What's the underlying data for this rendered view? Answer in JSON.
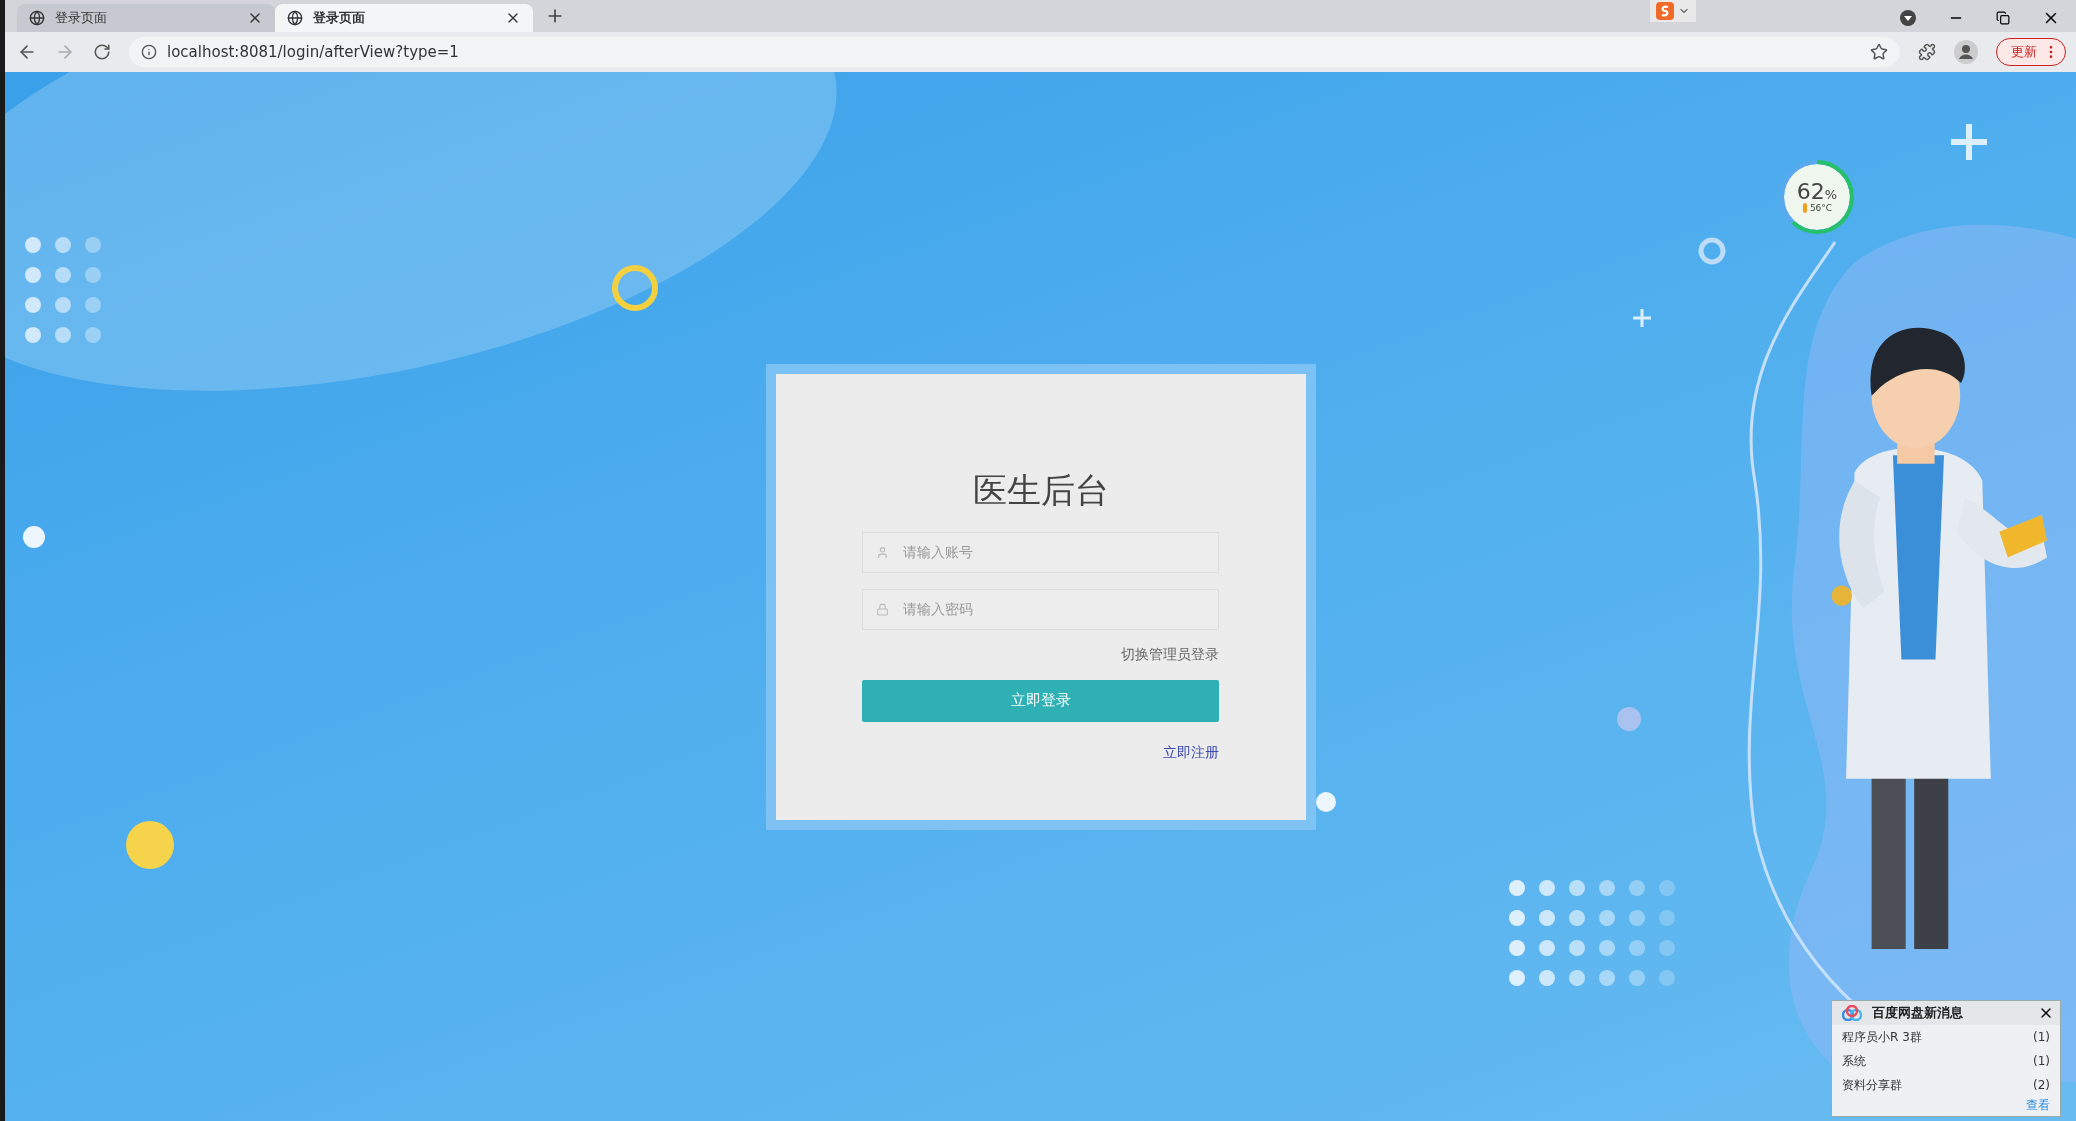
{
  "browser": {
    "tabs": [
      {
        "title": "登录页面",
        "selected": false
      },
      {
        "title": "登录页面",
        "selected": true
      }
    ],
    "address": "localhost:8081/login/afterView?type=1",
    "update_button": "更新"
  },
  "login": {
    "title": "医生后台",
    "fields": [
      {
        "kind": "user",
        "placeholder": "请输入账号"
      },
      {
        "kind": "password",
        "placeholder": "请输入密码"
      }
    ],
    "switch_link": "切换管理员登录",
    "submit": "立即登录",
    "register_link": "立即注册"
  },
  "cpu_widget": {
    "reading": "62",
    "unit": "%",
    "temperature": "56°C",
    "level": 0.62
  },
  "notification": {
    "title": "百度网盘新消息",
    "items": [
      {
        "name": "程序员小R 3群",
        "count": "(1)"
      },
      {
        "name": "系统",
        "count": "(1)"
      },
      {
        "name": "资料分享群",
        "count": "(2)"
      }
    ],
    "link": "查看"
  }
}
